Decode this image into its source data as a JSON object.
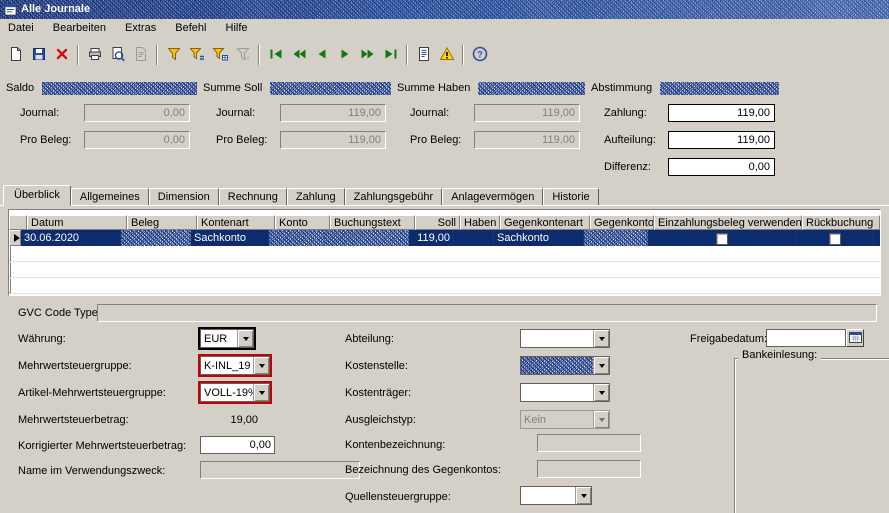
{
  "titlebar": {
    "title": "Alle Journale"
  },
  "menu": {
    "items": [
      "Datei",
      "Bearbeiten",
      "Extras",
      "Befehl",
      "Hilfe"
    ]
  },
  "toolbar": {
    "icons": [
      "new-record",
      "save",
      "delete",
      "print",
      "print-preview",
      "document-view",
      "filter",
      "filter-by-selection",
      "filter-by-field",
      "remove-filter",
      "first-record",
      "previous-area",
      "previous-record",
      "next-record",
      "next-area",
      "last-record",
      "document-handling",
      "warning",
      "help"
    ]
  },
  "summary": {
    "saldo": {
      "title": "Saldo",
      "journal_label": "Journal:",
      "journal_value": "0,00",
      "pro_beleg_label": "Pro Beleg:",
      "pro_beleg_value": "0,00"
    },
    "summe_soll": {
      "title": "Summe Soll",
      "journal_label": "Journal:",
      "journal_value": "119,00",
      "pro_beleg_label": "Pro Beleg:",
      "pro_beleg_value": "119,00"
    },
    "summe_haben": {
      "title": "Summe Haben",
      "journal_label": "Journal:",
      "journal_value": "119,00",
      "pro_beleg_label": "Pro Beleg:",
      "pro_beleg_value": "119,00"
    },
    "abstimmung": {
      "title": "Abstimmung",
      "zahlung_label": "Zahlung:",
      "zahlung_value": "119,00",
      "aufteilung_label": "Aufteilung:",
      "aufteilung_value": "119,00",
      "differenz_label": "Differenz:",
      "differenz_value": "0,00"
    }
  },
  "tabs": [
    "Überblick",
    "Allgemeines",
    "Dimension",
    "Rechnung",
    "Zahlung",
    "Zahlungsgebühr",
    "Anlagevermögen",
    "Historie"
  ],
  "grid": {
    "columns": [
      "Datum",
      "Beleg",
      "Kontenart",
      "Konto",
      "Buchungstext",
      "Soll",
      "Haben",
      "Gegenkontenart",
      "Gegenkonto",
      "Einzahlungsbeleg verwenden",
      "Rückbuchung"
    ],
    "selected_row": {
      "datum": "30.06.2020",
      "kontenart": "Sachkonto",
      "soll": "119,00",
      "haben": "",
      "gegenkontenart": "Sachkonto",
      "einzahlungsbeleg_checked": false,
      "rueckbuchung_checked": false
    }
  },
  "gvc": {
    "label": "GVC Code Typen:",
    "value": ""
  },
  "form": {
    "waehrung": {
      "label": "Währung:",
      "value": "EUR"
    },
    "mehrwertsteuergruppe": {
      "label": "Mehrwertsteuergruppe:",
      "value": "K-INL_19"
    },
    "artikel_mehrwertsteuergruppe": {
      "label": "Artikel-Mehrwertsteuergruppe:",
      "value": "VOLL-19%"
    },
    "mehrwertsteuerbetrag": {
      "label": "Mehrwertsteuerbetrag:",
      "value": "19,00"
    },
    "korrigierter_mehrwertsteuerbetrag": {
      "label": "Korrigierter Mehrwertsteuerbetrag:",
      "value": "0,00"
    },
    "name_im_verwendungszweck": {
      "label": "Name im Verwendungszweck:",
      "value": ""
    },
    "abteilung": {
      "label": "Abteilung:",
      "value": ""
    },
    "kostenstelle": {
      "label": "Kostenstelle:",
      "value": ""
    },
    "kostentraeger": {
      "label": "Kostenträger:",
      "value": ""
    },
    "ausgleichstyp": {
      "label": "Ausgleichstyp:",
      "value": "Kein"
    },
    "kontenbezeichnung": {
      "label": "Kontenbezeichnung:",
      "value": ""
    },
    "bezeichnung_des_gegenkontos": {
      "label": "Bezeichnung des Gegenkontos:",
      "value": ""
    },
    "quellensteuergruppe": {
      "label": "Quellensteuergruppe:",
      "value": ""
    },
    "freigabedatum": {
      "label": "Freigabedatum:",
      "value": ""
    },
    "bankeinlesung": {
      "label": "Bankeinlesung:"
    }
  },
  "colors": {
    "highlight_red": "#c40000",
    "selection_navy": "#0c2c6e",
    "titlebar_blue": "#0a246a"
  }
}
